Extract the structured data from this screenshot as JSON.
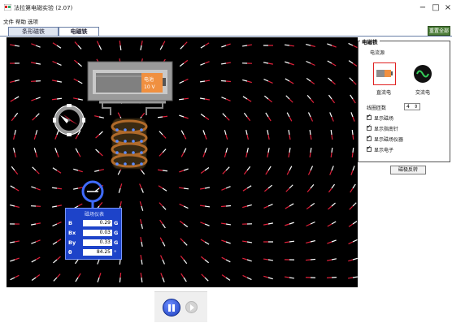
{
  "window": {
    "title": "法拉第电磁实验 (2.07)",
    "minimize": "−",
    "maximize": "□",
    "close": "×"
  },
  "menu": [
    "文件",
    "帮助",
    "选项"
  ],
  "tabs": [
    {
      "label": "条形磁铁",
      "active": false
    },
    {
      "label": "电磁铁",
      "active": true
    }
  ],
  "corner_button": "重置全部",
  "panel": {
    "title": "电磁铁",
    "source_label": "电流源",
    "dc_label": "直流电",
    "ac_label": "交流电",
    "loops_label": "线圈匝数",
    "loops_value": "4",
    "checkboxes": [
      {
        "label": "显示磁场",
        "checked": true
      },
      {
        "label": "显示指南针",
        "checked": true
      },
      {
        "label": "显示磁场仪器",
        "checked": true
      },
      {
        "label": "显示电子",
        "checked": true
      }
    ],
    "flip_button": "磁极反转"
  },
  "battery": {
    "voltage": "10 V"
  },
  "meter": {
    "title": "磁场仪表",
    "rows": [
      {
        "name": "B",
        "value": "0.29",
        "unit": "G"
      },
      {
        "name": "Bx",
        "value": "0.03",
        "unit": "G"
      },
      {
        "name": "By",
        "value": "0.33",
        "unit": "G"
      },
      {
        "name": "θ",
        "value": "84.25",
        "unit": "°"
      }
    ]
  },
  "colors": {
    "field_north": "#e0203a",
    "field_south": "#ffffff",
    "meter_bg": "#1d43c9",
    "coil": "#b06a2a"
  },
  "icons": {
    "pause": "pause-icon",
    "step": "step-icon",
    "dc": "battery-icon",
    "ac": "sine-wave-icon",
    "compass": "compass-icon",
    "probe": "field-probe-icon"
  }
}
